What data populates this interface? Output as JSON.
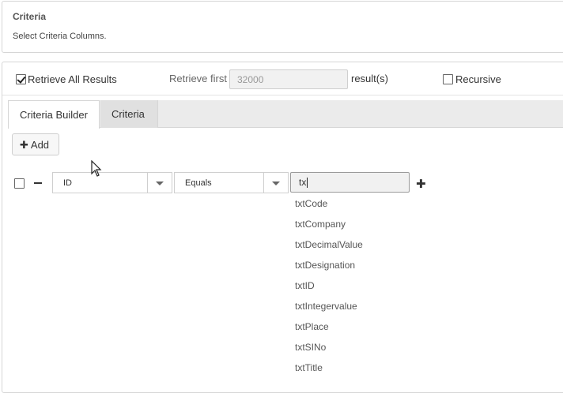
{
  "header": {
    "title": "Criteria",
    "subtitle": "Select Criteria Columns."
  },
  "options": {
    "retrieve_all_label": "Retrieve All Results",
    "retrieve_all_checked": true,
    "retrieve_first_label": "Retrieve first",
    "retrieve_first_value": "32000",
    "results_suffix": "result(s)",
    "recursive_label": "Recursive",
    "recursive_checked": false
  },
  "tabs": [
    {
      "label": "Criteria Builder",
      "active": true
    },
    {
      "label": "Criteria",
      "active": false
    }
  ],
  "toolbar": {
    "add_label": "Add"
  },
  "criteria_row": {
    "field_value": "ID",
    "operator_value": "Equals",
    "input_value": "tx"
  },
  "suggestions": [
    "txtCode",
    "txtCompany",
    "txtDecimalValue",
    "txtDesignation",
    "txtID",
    "txtIntegervalue",
    "txtPlace",
    "txtSINo",
    "txtTitle"
  ],
  "icons": {
    "plus": "plus-icon",
    "minus": "minus-icon",
    "caret": "chevron-down-icon",
    "check": "check-icon",
    "pointer": "mouse-pointer-icon"
  }
}
